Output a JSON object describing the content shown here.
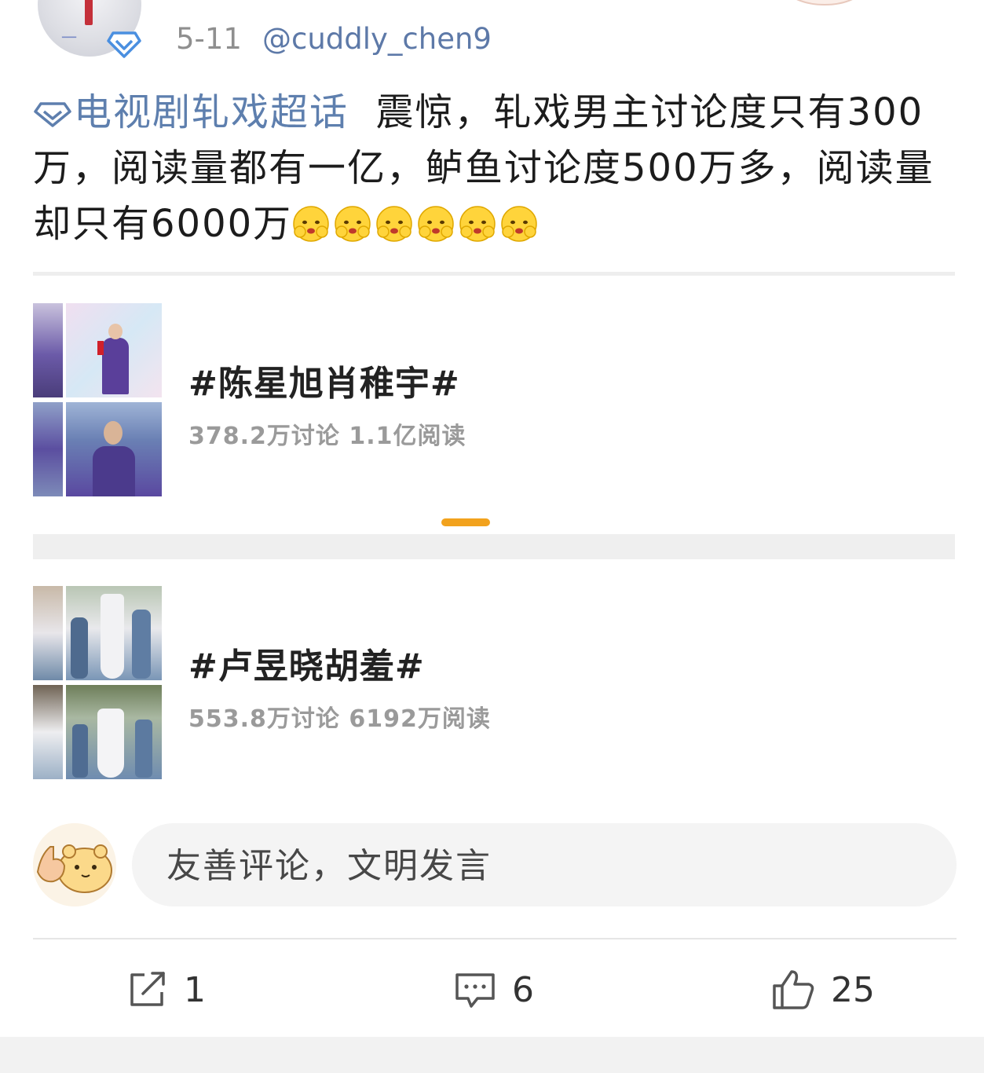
{
  "header": {
    "date": "5-11",
    "username": "@cuddly_chen9"
  },
  "post": {
    "topic_link": "电视剧轧戏超话",
    "text": "震惊，轧戏男主讨论度只有300万，阅读量都有一亿，鲈鱼讨论度500万多，阅读量却只有6000万",
    "emoji_count": 6
  },
  "topics": [
    {
      "title": "#陈星旭肖稚宇#",
      "stats": "378.2万讨论 1.1亿阅读"
    },
    {
      "title": "#卢昱晓胡羞#",
      "stats": "553.8万讨论 6192万阅读"
    }
  ],
  "comment_input": {
    "placeholder": "友善评论，文明发言"
  },
  "actions": {
    "repost_count": "1",
    "comment_count": "6",
    "like_count": "25"
  },
  "colors": {
    "link": "#5e7fae",
    "accent_indicator": "#f2a21d",
    "muted_text": "#9a9a9a"
  }
}
